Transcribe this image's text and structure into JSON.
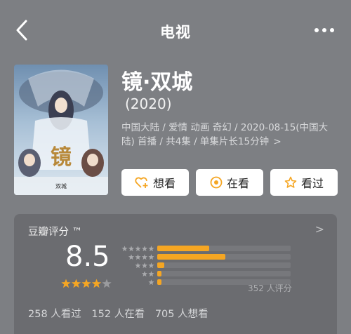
{
  "header": {
    "title": "电视"
  },
  "movie": {
    "title": "镜·双城",
    "year": "(2020)",
    "meta": "中国大陆 / 爱情 动画 奇幻 / 2020-08-15(中国大陆) 首播 / 共4集 / 单集片长15分钟",
    "meta_chevron": ">",
    "poster_text_main": "镜",
    "poster_text_sub": "双城"
  },
  "actions": {
    "want": "想看",
    "watching": "在看",
    "watched": "看过"
  },
  "rating": {
    "label": "豆瓣评分 ™",
    "chevron": ">",
    "score": "8.5",
    "stars_shown": 4,
    "distribution_percent": [
      39,
      51,
      5,
      3,
      3
    ],
    "count_text": "352 人评分",
    "stats": [
      "258 人看过",
      "152 人在看",
      "705 人想看"
    ]
  },
  "colors": {
    "background": "#7d7f83",
    "card": "#6b6c70",
    "accent": "#f5a623"
  }
}
